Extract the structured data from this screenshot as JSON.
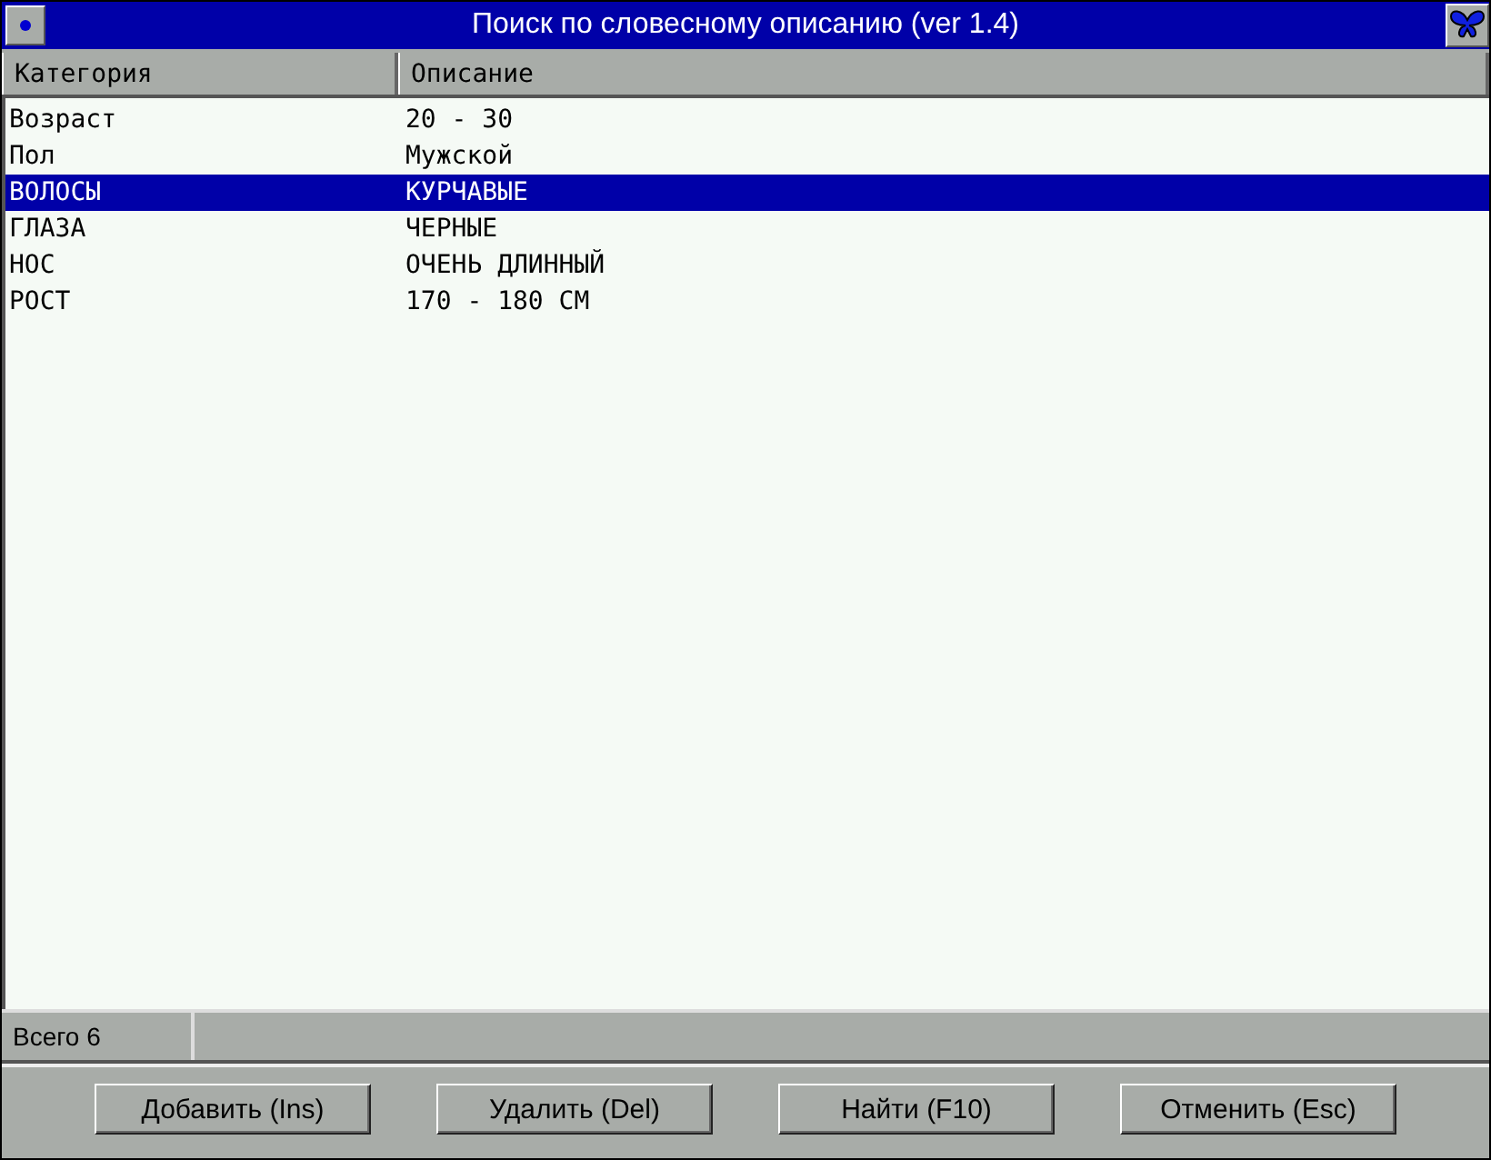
{
  "window": {
    "title": "Поиск по словесному описанию (ver 1.4)"
  },
  "table": {
    "columns": [
      "Категория",
      "Описание"
    ],
    "rows": [
      {
        "category": "Возраст",
        "description": "20 - 30",
        "selected": false
      },
      {
        "category": "Пол",
        "description": "Мужской",
        "selected": false
      },
      {
        "category": "ВОЛОСЫ",
        "description": "КУРЧАВЫЕ",
        "selected": true
      },
      {
        "category": "ГЛАЗА",
        "description": "ЧЕРНЫЕ",
        "selected": false
      },
      {
        "category": "НОС",
        "description": "ОЧЕНЬ ДЛИННЫЙ",
        "selected": false
      },
      {
        "category": "РОСТ",
        "description": "170 - 180 СМ",
        "selected": false
      }
    ]
  },
  "status_bar": {
    "count": "Всего 6"
  },
  "buttons": [
    "Добавить (Ins)",
    "Удалить (Del)",
    "Найти (F10)",
    "Отменить (Esc)"
  ]
}
